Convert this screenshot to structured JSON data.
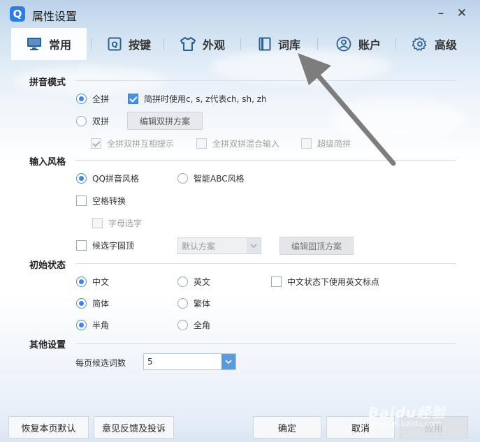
{
  "window": {
    "logo_letter": "Q",
    "title": "属性设置",
    "minimize_label": "–",
    "close_label": "✕"
  },
  "tabs": [
    {
      "label": "常用",
      "icon": "monitor-icon",
      "active": true
    },
    {
      "label": "按键",
      "icon": "keyboard-key-icon",
      "active": false
    },
    {
      "label": "外观",
      "icon": "shirt-icon",
      "active": false
    },
    {
      "label": "词库",
      "icon": "book-icon",
      "active": false
    },
    {
      "label": "账户",
      "icon": "user-icon",
      "active": false
    },
    {
      "label": "高级",
      "icon": "gear-icon",
      "active": false
    }
  ],
  "pinyin_mode": {
    "title": "拼音模式",
    "full_pinyin": "全拼",
    "abbr_option": "简拼时使用c, s, z代表ch, sh, zh",
    "double_pinyin": "双拼",
    "edit_double_btn": "编辑双拼方案",
    "hint_option": "全拼双拼互相提示",
    "mixed_option": "全拼双拼混合输入",
    "super_abbr": "超级简拼"
  },
  "input_style": {
    "title": "输入风格",
    "qq_style": "QQ拼音风格",
    "abc_style": "智能ABC风格",
    "space_convert": "空格转换",
    "letter_select": "字母选字",
    "fix_candidate": "候选字固顶",
    "fix_scheme_value": "默认方案",
    "edit_fix_btn": "编辑固顶方案"
  },
  "initial_state": {
    "title": "初始状态",
    "chinese": "中文",
    "english": "英文",
    "english_punct": "中文状态下使用英文标点",
    "simplified": "简体",
    "traditional": "繁体",
    "half_width": "半角",
    "full_width": "全角"
  },
  "other": {
    "title": "其他设置",
    "per_page_label": "每页候选词数",
    "per_page_value": "5"
  },
  "footer": {
    "restore_btn": "恢复本页默认",
    "feedback_btn": "意见反馈及投诉",
    "ok_btn": "确定",
    "cancel_btn": "取消",
    "apply_btn": "应用"
  },
  "watermark": {
    "brand": "Baidu经验",
    "url": "jingyan.baidu.com"
  },
  "colors": {
    "accent": "#3f87df",
    "annotation_arrow": "#7d7d7d"
  }
}
